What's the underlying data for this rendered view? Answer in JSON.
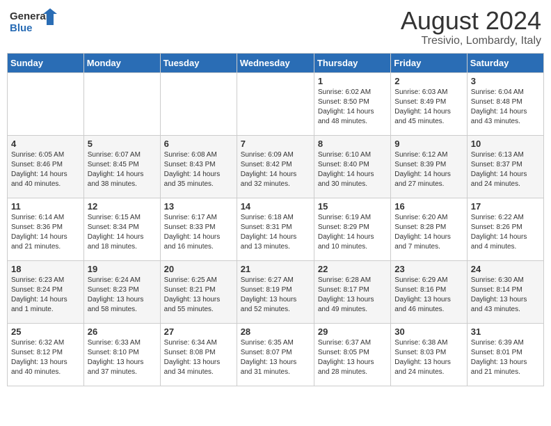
{
  "header": {
    "logo_general": "General",
    "logo_blue": "Blue",
    "month_title": "August 2024",
    "location": "Tresivio, Lombardy, Italy"
  },
  "weekdays": [
    "Sunday",
    "Monday",
    "Tuesday",
    "Wednesday",
    "Thursday",
    "Friday",
    "Saturday"
  ],
  "weeks": [
    [
      {
        "day": "",
        "info": ""
      },
      {
        "day": "",
        "info": ""
      },
      {
        "day": "",
        "info": ""
      },
      {
        "day": "",
        "info": ""
      },
      {
        "day": "1",
        "info": "Sunrise: 6:02 AM\nSunset: 8:50 PM\nDaylight: 14 hours\nand 48 minutes."
      },
      {
        "day": "2",
        "info": "Sunrise: 6:03 AM\nSunset: 8:49 PM\nDaylight: 14 hours\nand 45 minutes."
      },
      {
        "day": "3",
        "info": "Sunrise: 6:04 AM\nSunset: 8:48 PM\nDaylight: 14 hours\nand 43 minutes."
      }
    ],
    [
      {
        "day": "4",
        "info": "Sunrise: 6:05 AM\nSunset: 8:46 PM\nDaylight: 14 hours\nand 40 minutes."
      },
      {
        "day": "5",
        "info": "Sunrise: 6:07 AM\nSunset: 8:45 PM\nDaylight: 14 hours\nand 38 minutes."
      },
      {
        "day": "6",
        "info": "Sunrise: 6:08 AM\nSunset: 8:43 PM\nDaylight: 14 hours\nand 35 minutes."
      },
      {
        "day": "7",
        "info": "Sunrise: 6:09 AM\nSunset: 8:42 PM\nDaylight: 14 hours\nand 32 minutes."
      },
      {
        "day": "8",
        "info": "Sunrise: 6:10 AM\nSunset: 8:40 PM\nDaylight: 14 hours\nand 30 minutes."
      },
      {
        "day": "9",
        "info": "Sunrise: 6:12 AM\nSunset: 8:39 PM\nDaylight: 14 hours\nand 27 minutes."
      },
      {
        "day": "10",
        "info": "Sunrise: 6:13 AM\nSunset: 8:37 PM\nDaylight: 14 hours\nand 24 minutes."
      }
    ],
    [
      {
        "day": "11",
        "info": "Sunrise: 6:14 AM\nSunset: 8:36 PM\nDaylight: 14 hours\nand 21 minutes."
      },
      {
        "day": "12",
        "info": "Sunrise: 6:15 AM\nSunset: 8:34 PM\nDaylight: 14 hours\nand 18 minutes."
      },
      {
        "day": "13",
        "info": "Sunrise: 6:17 AM\nSunset: 8:33 PM\nDaylight: 14 hours\nand 16 minutes."
      },
      {
        "day": "14",
        "info": "Sunrise: 6:18 AM\nSunset: 8:31 PM\nDaylight: 14 hours\nand 13 minutes."
      },
      {
        "day": "15",
        "info": "Sunrise: 6:19 AM\nSunset: 8:29 PM\nDaylight: 14 hours\nand 10 minutes."
      },
      {
        "day": "16",
        "info": "Sunrise: 6:20 AM\nSunset: 8:28 PM\nDaylight: 14 hours\nand 7 minutes."
      },
      {
        "day": "17",
        "info": "Sunrise: 6:22 AM\nSunset: 8:26 PM\nDaylight: 14 hours\nand 4 minutes."
      }
    ],
    [
      {
        "day": "18",
        "info": "Sunrise: 6:23 AM\nSunset: 8:24 PM\nDaylight: 14 hours\nand 1 minute."
      },
      {
        "day": "19",
        "info": "Sunrise: 6:24 AM\nSunset: 8:23 PM\nDaylight: 13 hours\nand 58 minutes."
      },
      {
        "day": "20",
        "info": "Sunrise: 6:25 AM\nSunset: 8:21 PM\nDaylight: 13 hours\nand 55 minutes."
      },
      {
        "day": "21",
        "info": "Sunrise: 6:27 AM\nSunset: 8:19 PM\nDaylight: 13 hours\nand 52 minutes."
      },
      {
        "day": "22",
        "info": "Sunrise: 6:28 AM\nSunset: 8:17 PM\nDaylight: 13 hours\nand 49 minutes."
      },
      {
        "day": "23",
        "info": "Sunrise: 6:29 AM\nSunset: 8:16 PM\nDaylight: 13 hours\nand 46 minutes."
      },
      {
        "day": "24",
        "info": "Sunrise: 6:30 AM\nSunset: 8:14 PM\nDaylight: 13 hours\nand 43 minutes."
      }
    ],
    [
      {
        "day": "25",
        "info": "Sunrise: 6:32 AM\nSunset: 8:12 PM\nDaylight: 13 hours\nand 40 minutes."
      },
      {
        "day": "26",
        "info": "Sunrise: 6:33 AM\nSunset: 8:10 PM\nDaylight: 13 hours\nand 37 minutes."
      },
      {
        "day": "27",
        "info": "Sunrise: 6:34 AM\nSunset: 8:08 PM\nDaylight: 13 hours\nand 34 minutes."
      },
      {
        "day": "28",
        "info": "Sunrise: 6:35 AM\nSunset: 8:07 PM\nDaylight: 13 hours\nand 31 minutes."
      },
      {
        "day": "29",
        "info": "Sunrise: 6:37 AM\nSunset: 8:05 PM\nDaylight: 13 hours\nand 28 minutes."
      },
      {
        "day": "30",
        "info": "Sunrise: 6:38 AM\nSunset: 8:03 PM\nDaylight: 13 hours\nand 24 minutes."
      },
      {
        "day": "31",
        "info": "Sunrise: 6:39 AM\nSunset: 8:01 PM\nDaylight: 13 hours\nand 21 minutes."
      }
    ]
  ]
}
